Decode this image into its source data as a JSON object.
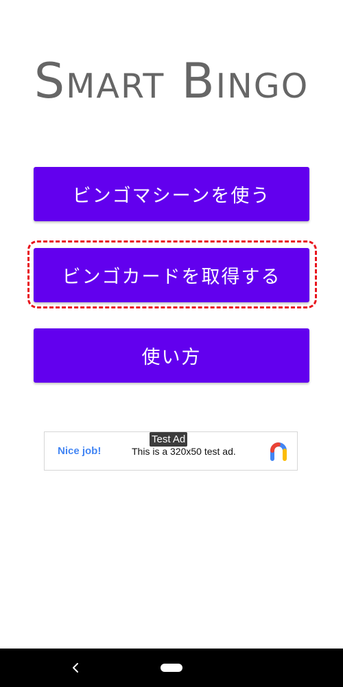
{
  "app": {
    "title": "Smart Bingo"
  },
  "menu": {
    "machine_label": "ビンゴマシーンを使う",
    "card_label": "ビンゴカードを取得する",
    "howto_label": "使い方"
  },
  "ad": {
    "label": "Test Ad",
    "nice_text": "Nice job!",
    "body_text": "This is a 320x50 test ad."
  },
  "colors": {
    "primary": "#6200ee",
    "title_gray": "#666666",
    "highlight": "#e8141c"
  },
  "icons": {
    "ad_logo": "google-ads-logo-icon",
    "back": "back-icon",
    "home": "home-icon"
  }
}
